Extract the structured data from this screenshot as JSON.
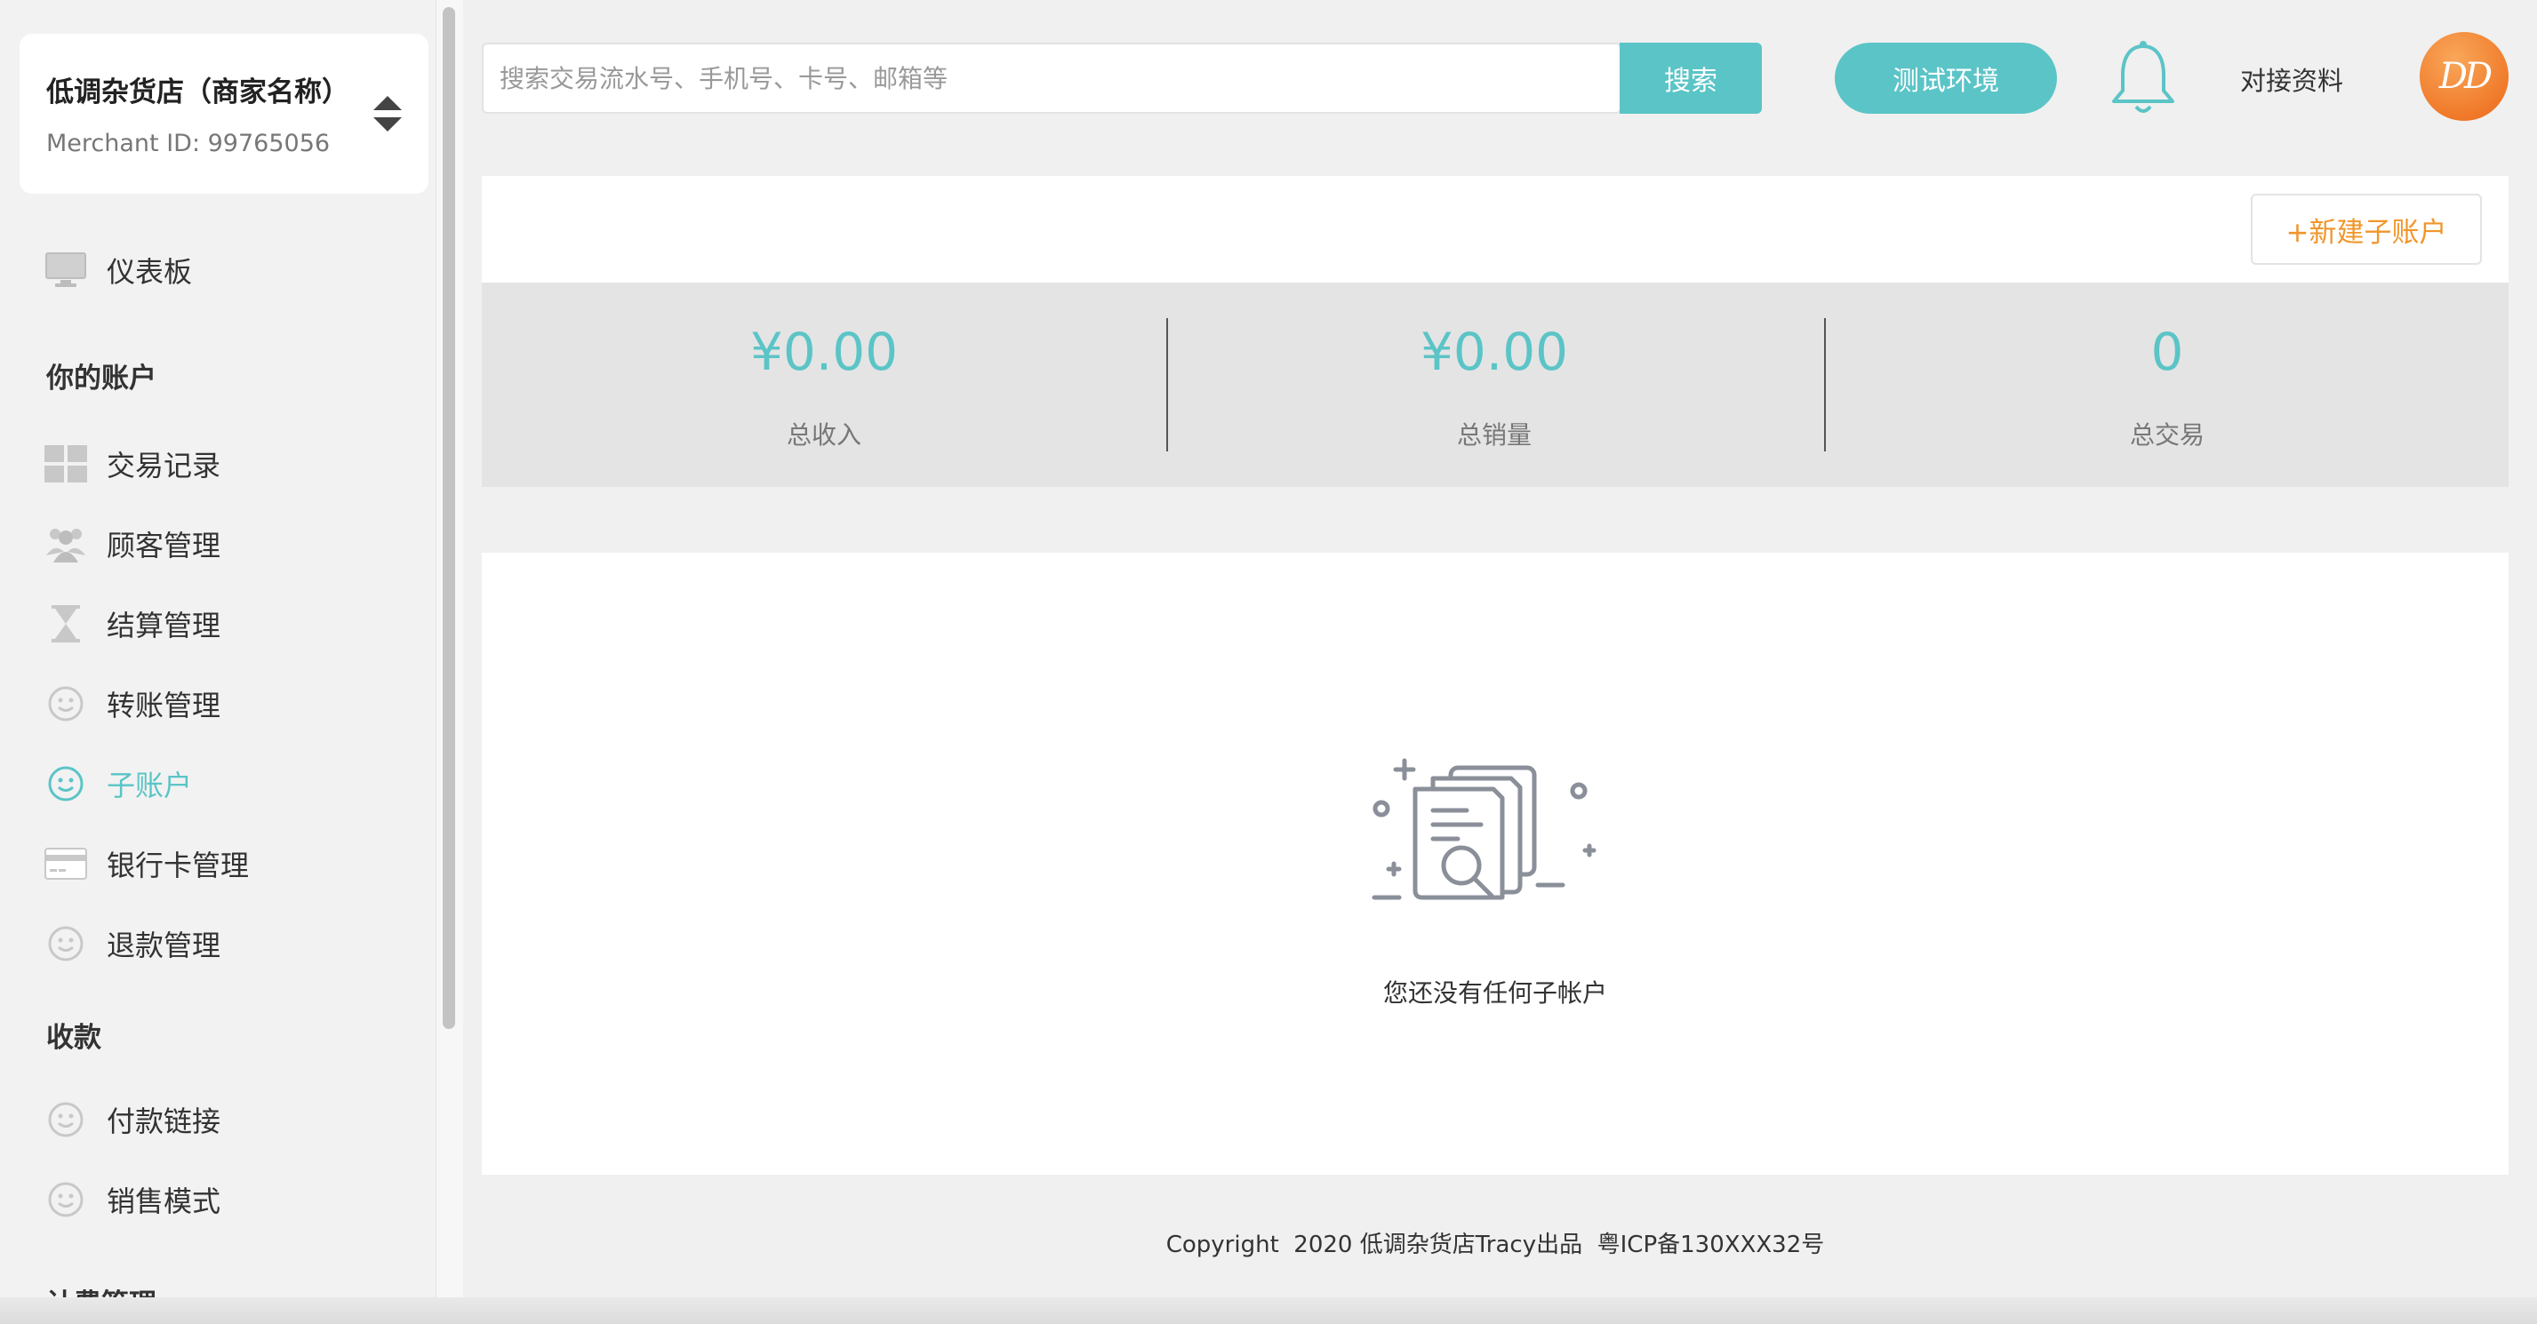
{
  "sidebar": {
    "merchant_name": "低调杂货店（商家名称）",
    "merchant_id": "Merchant ID: 99765056",
    "dashboard": {
      "label": "仪表板",
      "icon": "monitor-icon"
    },
    "section_account": "你的账户",
    "account_items": [
      {
        "label": "交易记录",
        "icon": "grid-icon"
      },
      {
        "label": "顾客管理",
        "icon": "users-icon"
      },
      {
        "label": "结算管理",
        "icon": "hourglass-icon"
      },
      {
        "label": "转账管理",
        "icon": "smiley-icon"
      },
      {
        "label": "子账户",
        "icon": "smiley-icon",
        "active": true
      },
      {
        "label": "银行卡管理",
        "icon": "card-icon"
      },
      {
        "label": "退款管理",
        "icon": "smiley-icon"
      }
    ],
    "section_payments": "收款",
    "payment_items": [
      {
        "label": "付款链接",
        "icon": "smiley-icon"
      },
      {
        "label": "销售模式",
        "icon": "smiley-icon"
      }
    ],
    "section_partial": "计费管理"
  },
  "header": {
    "search_placeholder": "搜索交易流水号、手机号、卡号、邮箱等",
    "search_button": "搜索",
    "env_button": "测试环境",
    "docs_link": "对接资料",
    "avatar_text": "DD"
  },
  "main": {
    "new_subaccount_button": "+新建子账户",
    "stats": [
      {
        "value": "¥0.00",
        "label": "总收入"
      },
      {
        "value": "¥0.00",
        "label": "总销量"
      },
      {
        "value": "0",
        "label": "总交易"
      }
    ],
    "empty_message": "您还没有任何子帐户"
  },
  "footer": {
    "text": "Copyright  2020 低调杂货店Tracy出品  粤ICP备130XXX32号"
  },
  "colors": {
    "accent": "#5bc4c7",
    "orange": "#f0962b",
    "avatar": "#f07a2a"
  }
}
